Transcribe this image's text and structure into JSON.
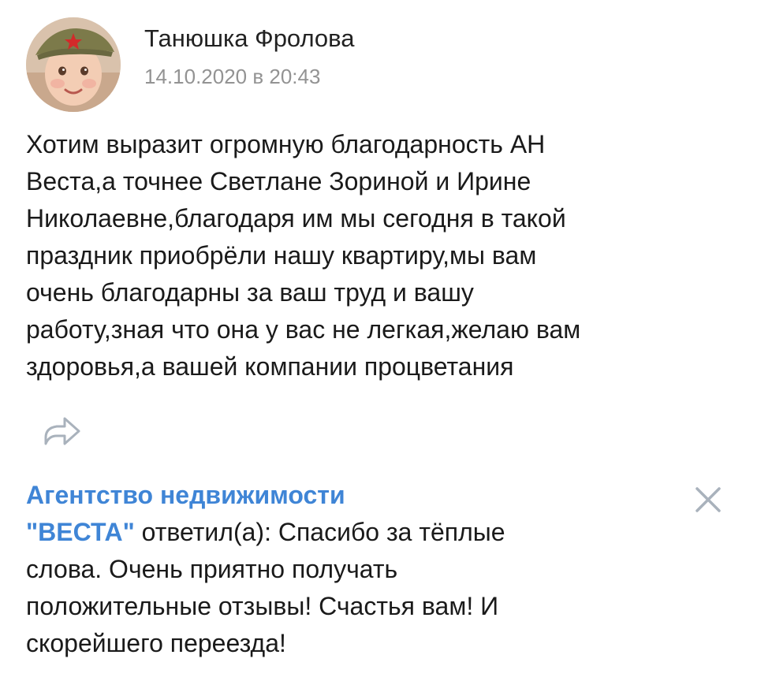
{
  "post": {
    "author_name": "Танюшка Фролова",
    "date": "14.10.2020 в 20:43",
    "text": "Хотим выразит огромную благодарность АН\nВеста,а точнее Светлане Зориной и Ирине\nНиколаевне,благодаря им мы сегодня в такой\nпраздник приобрёли нашу квартиру,мы вам\nочень благодарны за ваш труд и вашу\nработу,зная что она у вас не легкая,желаю вам\nздоровья,а вашей компании процветания",
    "share_icon": "share-arrow-icon"
  },
  "reply": {
    "author_line1": "Агентство недвижимости",
    "author_line2": "\"ВЕСТА\"",
    "replied_label": " ответил(а): ",
    "text": "Спасибо за тёплые\nслова. Очень приятно получать\nположительные отзывы! Счастья вам! И\nскорейшего переезда!",
    "close_icon": "close-icon"
  },
  "colors": {
    "link": "#3f85d6",
    "date": "#939393",
    "icon": "#a9b2bc",
    "text": "#1a1a1a"
  }
}
